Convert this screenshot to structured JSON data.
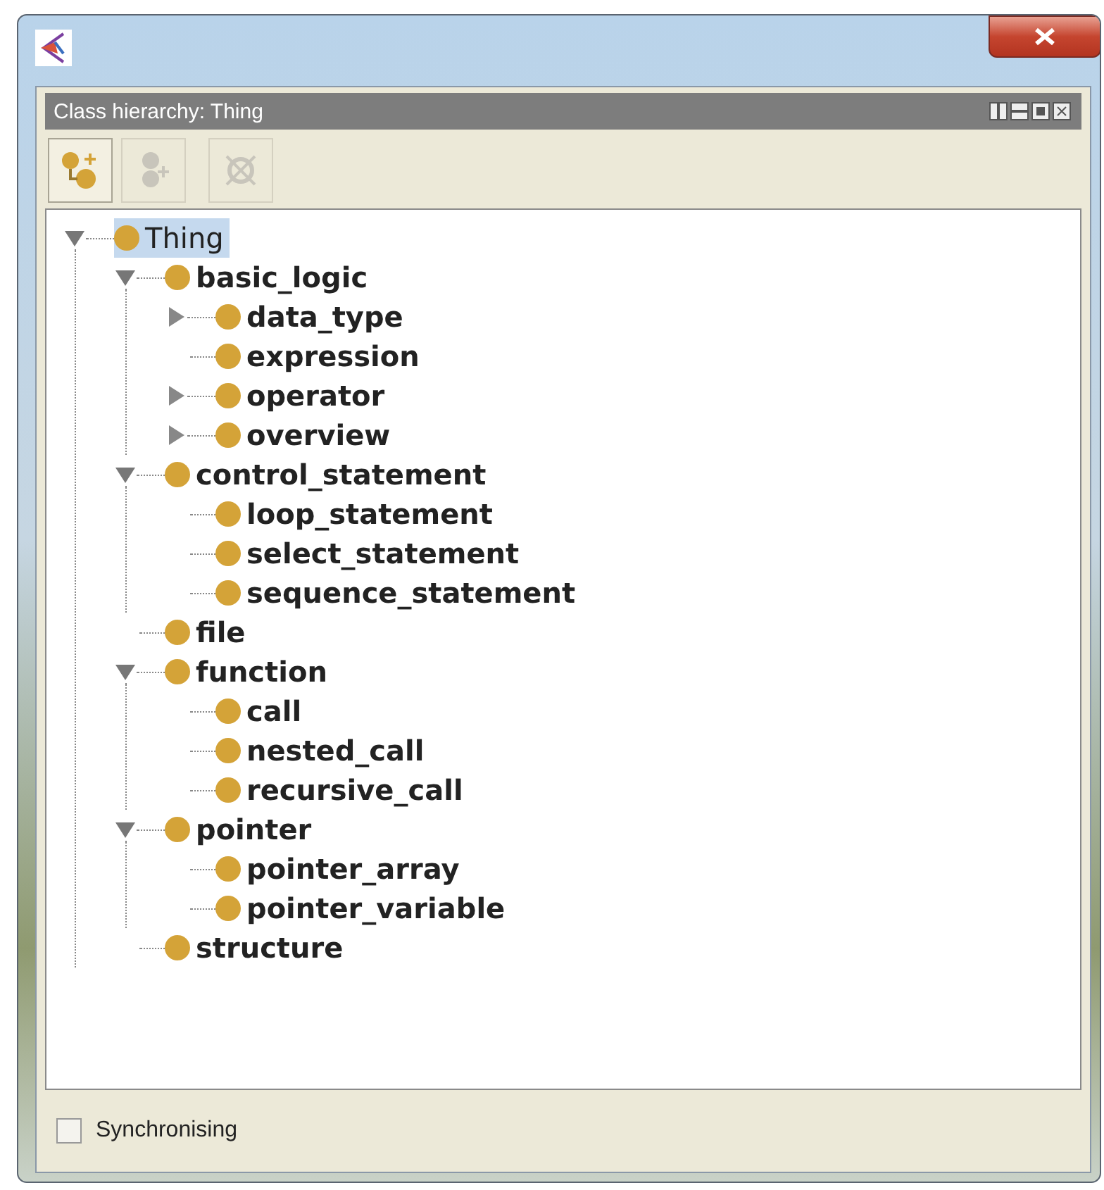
{
  "panel": {
    "title": "Class hierarchy: Thing"
  },
  "toolbar": [
    {
      "kind": "add-subclass",
      "disabled": false
    },
    {
      "kind": "add-sibling",
      "disabled": true
    },
    {
      "kind": "delete",
      "disabled": true
    }
  ],
  "tree": [
    {
      "label": "Thing",
      "selected": true,
      "expanded": true,
      "children": [
        {
          "label": "basic_logic",
          "selected": false,
          "expanded": true,
          "children": [
            {
              "label": "data_type",
              "selected": false,
              "expanded": false
            },
            {
              "label": "expression",
              "selected": false
            },
            {
              "label": "operator",
              "selected": false,
              "expanded": false
            },
            {
              "label": "overview",
              "selected": false,
              "expanded": false
            }
          ]
        },
        {
          "label": "control_statement",
          "selected": false,
          "expanded": true,
          "children": [
            {
              "label": "loop_statement",
              "selected": false
            },
            {
              "label": "select_statement",
              "selected": false
            },
            {
              "label": "sequence_statement",
              "selected": false
            }
          ]
        },
        {
          "label": "file",
          "selected": false
        },
        {
          "label": "function",
          "selected": false,
          "expanded": true,
          "children": [
            {
              "label": "call",
              "selected": false
            },
            {
              "label": "nested_call",
              "selected": false
            },
            {
              "label": "recursive_call",
              "selected": false
            }
          ]
        },
        {
          "label": "pointer",
          "selected": false,
          "expanded": true,
          "children": [
            {
              "label": "pointer_array",
              "selected": false
            },
            {
              "label": "pointer_variable",
              "selected": false
            }
          ]
        },
        {
          "label": "structure",
          "selected": false
        }
      ]
    }
  ],
  "footer": {
    "label": "Synchronising",
    "checked": false
  }
}
